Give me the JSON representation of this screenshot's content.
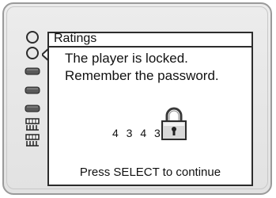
{
  "panel": {
    "title": "Ratings",
    "message_line1": "The player is locked.",
    "message_line2": "Remember the password.",
    "password": "4 3 4 3",
    "footer": "Press SELECT to continue"
  },
  "sidebar": {
    "items": [
      {
        "icon": "circle-icon"
      },
      {
        "icon": "circle-icon"
      },
      {
        "icon": "pill-icon"
      },
      {
        "icon": "pill-icon"
      },
      {
        "icon": "pill-icon"
      },
      {
        "icon": "group-icon"
      },
      {
        "icon": "group-icon"
      }
    ]
  },
  "colors": {
    "bezel": "#e6e6e6",
    "panel_border": "#2c2c2c",
    "lock_body": "#d8d8d8"
  }
}
